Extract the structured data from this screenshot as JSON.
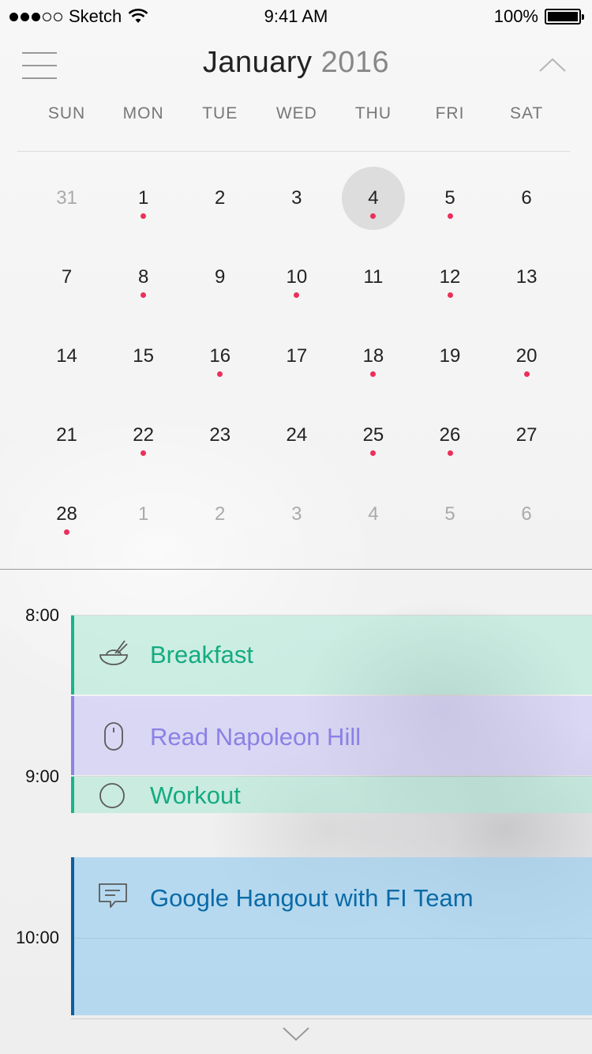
{
  "status_bar": {
    "carrier": "Sketch",
    "time": "9:41 AM",
    "battery": "100%"
  },
  "header": {
    "month": "January",
    "year": "2016"
  },
  "weekdays": [
    "SUN",
    "MON",
    "TUE",
    "WED",
    "THU",
    "FRI",
    "SAT"
  ],
  "calendar": {
    "weeks": [
      [
        {
          "label": "31",
          "muted": true,
          "event": false
        },
        {
          "label": "1",
          "muted": false,
          "event": true
        },
        {
          "label": "2",
          "muted": false,
          "event": false
        },
        {
          "label": "3",
          "muted": false,
          "event": false
        },
        {
          "label": "4",
          "muted": false,
          "event": true,
          "selected": true
        },
        {
          "label": "5",
          "muted": false,
          "event": true
        },
        {
          "label": "6",
          "muted": false,
          "event": false
        }
      ],
      [
        {
          "label": "7",
          "muted": false,
          "event": false
        },
        {
          "label": "8",
          "muted": false,
          "event": true
        },
        {
          "label": "9",
          "muted": false,
          "event": false
        },
        {
          "label": "10",
          "muted": false,
          "event": true
        },
        {
          "label": "11",
          "muted": false,
          "event": false
        },
        {
          "label": "12",
          "muted": false,
          "event": true
        },
        {
          "label": "13",
          "muted": false,
          "event": false
        }
      ],
      [
        {
          "label": "14",
          "muted": false,
          "event": false
        },
        {
          "label": "15",
          "muted": false,
          "event": false
        },
        {
          "label": "16",
          "muted": false,
          "event": true
        },
        {
          "label": "17",
          "muted": false,
          "event": false
        },
        {
          "label": "18",
          "muted": false,
          "event": true
        },
        {
          "label": "19",
          "muted": false,
          "event": false
        },
        {
          "label": "20",
          "muted": false,
          "event": true
        }
      ],
      [
        {
          "label": "21",
          "muted": false,
          "event": false
        },
        {
          "label": "22",
          "muted": false,
          "event": true
        },
        {
          "label": "23",
          "muted": false,
          "event": false
        },
        {
          "label": "24",
          "muted": false,
          "event": false
        },
        {
          "label": "25",
          "muted": false,
          "event": true
        },
        {
          "label": "26",
          "muted": false,
          "event": true
        },
        {
          "label": "27",
          "muted": false,
          "event": false
        }
      ],
      [
        {
          "label": "28",
          "muted": false,
          "event": true
        },
        {
          "label": "1",
          "muted": true,
          "event": false
        },
        {
          "label": "2",
          "muted": true,
          "event": false
        },
        {
          "label": "3",
          "muted": true,
          "event": false
        },
        {
          "label": "4",
          "muted": true,
          "event": false
        },
        {
          "label": "5",
          "muted": true,
          "event": false
        },
        {
          "label": "6",
          "muted": true,
          "event": false
        }
      ]
    ]
  },
  "times": [
    "8:00",
    "9:00",
    "10:00"
  ],
  "events": [
    {
      "title": "Breakfast",
      "icon": "bowl-icon",
      "color": "#17b588"
    },
    {
      "title": "Read Napoleon Hill",
      "icon": "mouse-icon",
      "color": "#8d82e8"
    },
    {
      "title": "Workout",
      "icon": "circle-icon",
      "color": "#17b588"
    },
    {
      "title": "Google Hangout with FI Team",
      "icon": "chat-bubble-icon",
      "color": "#0a5fa0"
    }
  ],
  "colors": {
    "event_dot": "#ec2f5a",
    "selected_day": "#dddddd"
  }
}
